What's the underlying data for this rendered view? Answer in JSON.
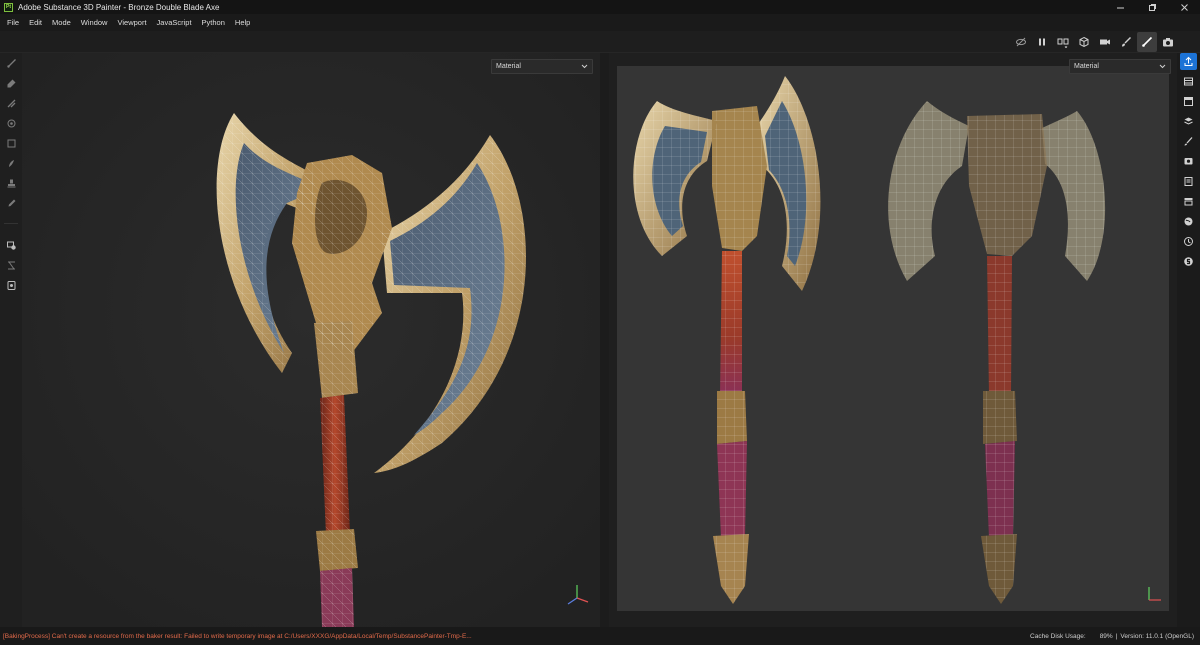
{
  "window": {
    "title": "Adobe Substance 3D Painter - Bronze Double Blade Axe",
    "logo_text": "Pt"
  },
  "menu": [
    "File",
    "Edit",
    "Mode",
    "Window",
    "Viewport",
    "JavaScript",
    "Python",
    "Help"
  ],
  "toolbar": {
    "icons": [
      "hide-icon",
      "pause-icon",
      "split-view-icon",
      "cube-icon",
      "camera-icon",
      "brush-icon",
      "paintbrush-icon",
      "screenshot-icon"
    ],
    "active": "paintbrush-icon"
  },
  "viewport_3d": {
    "channel": "Material"
  },
  "viewport_2d": {
    "channel": "Material"
  },
  "right_panel": {
    "icons": [
      "export-icon",
      "layers-stack-icon",
      "texture-set-icon",
      "layers-icon",
      "brush-settings-icon",
      "display-icon",
      "properties-icon",
      "shelf-icon",
      "environment-icon",
      "history-icon",
      "substance-icon"
    ],
    "active": "export-icon"
  },
  "status": {
    "error": "[BakingProcess] Can't create a resource from the baker result: Failed to write temporary image at C:/Users/XXXG/AppData/Local/Temp/SubstancePainter-Tmp-E...",
    "cache_label": "Cache Disk Usage:",
    "cache_value": "89%",
    "separator": "|",
    "version": "Version: 11.0.1 (OpenGL)"
  },
  "colors": {
    "accent": "#1c73d6",
    "error": "#e26a4a",
    "bronze": "#c8ad7a",
    "steel": "#5a6f86",
    "handle": "#a3402a"
  }
}
